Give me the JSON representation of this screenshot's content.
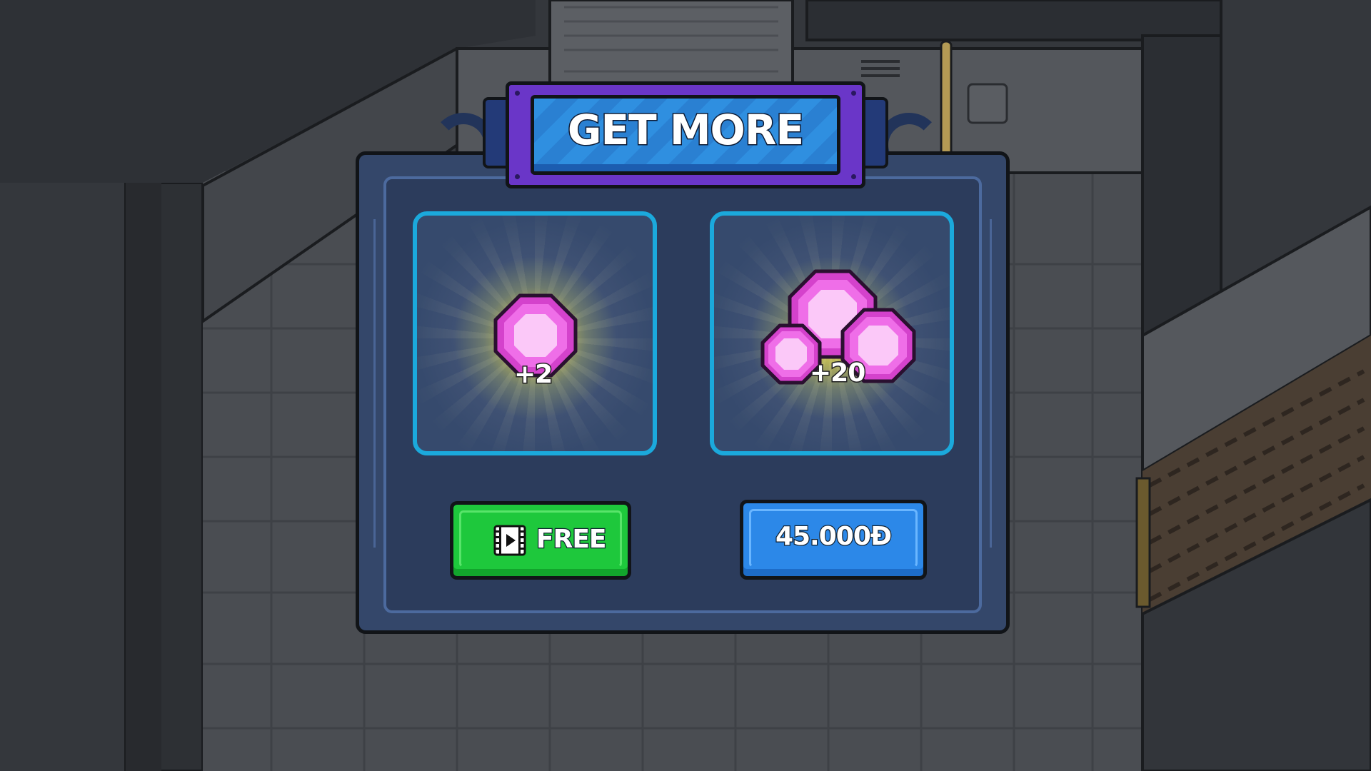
{
  "dialog": {
    "title": "GET MORE"
  },
  "offers": [
    {
      "amount": "+2",
      "button_label": "FREE",
      "button_icon": "video-play-icon",
      "button_color": "#1ec83c"
    },
    {
      "amount": "+20",
      "button_label": "45.000Đ",
      "button_color": "#2c88e8"
    }
  ],
  "colors": {
    "banner_purple": "#6a36c8",
    "banner_blue": "#2f8fe0",
    "card_border": "#1ba9dc",
    "gem_pink": "#e65ee0",
    "panel": "#34476a"
  }
}
